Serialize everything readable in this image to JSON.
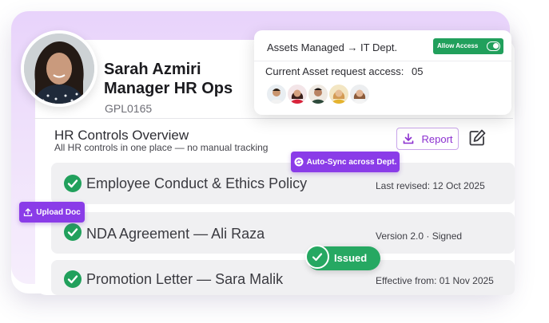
{
  "profile": {
    "name": "Sarah Azmiri",
    "title": "Manager HR Ops",
    "employee_id": "GPL0165"
  },
  "overview": {
    "title": "HR Controls Overview",
    "subtitle": "All HR controls in one place — no manual tracking",
    "report_label": "Report"
  },
  "assets_card": {
    "title": "Assets Managed → IT Dept.",
    "allow_access_label": "Allow Access",
    "allow_access_on": true,
    "request_label": "Current Asset request access:",
    "request_count": "05"
  },
  "badges": {
    "auto_sync": "Auto-Sync across Dept.",
    "upload_doc": "Upload Doc",
    "issued": "Issued"
  },
  "documents": [
    {
      "title": "Employee Conduct & Ethics Policy",
      "meta": "Last revised: 12 Oct 2025"
    },
    {
      "title": "NDA Agreement — Ali Raza",
      "meta": "Version 2.0 · Signed"
    },
    {
      "title": "Promotion Letter — Sara Malik",
      "meta": "Effective from: 01 Nov 2025"
    }
  ],
  "colors": {
    "accent_purple": "#8a3ce8",
    "success_green": "#21a05c",
    "background_lavender": "#ead6fb"
  },
  "icons": [
    "download-icon",
    "edit-icon",
    "check-icon",
    "sync-icon",
    "upload-icon",
    "toggle-icon"
  ]
}
